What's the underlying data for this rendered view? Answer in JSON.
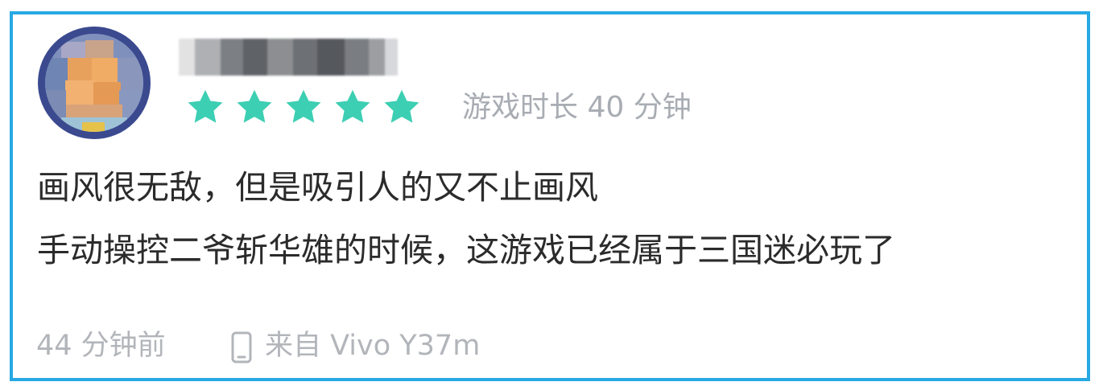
{
  "review": {
    "username_display": "用户名已打码",
    "rating": 5,
    "rating_max": 5,
    "playtime": "游戏时长 40 分钟",
    "content_lines": [
      "画风很无敌，但是吸引人的又不止画风",
      "手动操控二爷斩华雄的时候，这游戏已经属于三国迷必玩了"
    ],
    "posted_ago": "44 分钟前",
    "device": "来自 Vivo Y37m"
  },
  "colors": {
    "border": "#27a9e3",
    "star": "#3ccfb3",
    "muted_text": "#a8acb3",
    "main_text": "#2b2b2b"
  },
  "icons": {
    "star": "star-icon",
    "device": "phone-icon"
  }
}
